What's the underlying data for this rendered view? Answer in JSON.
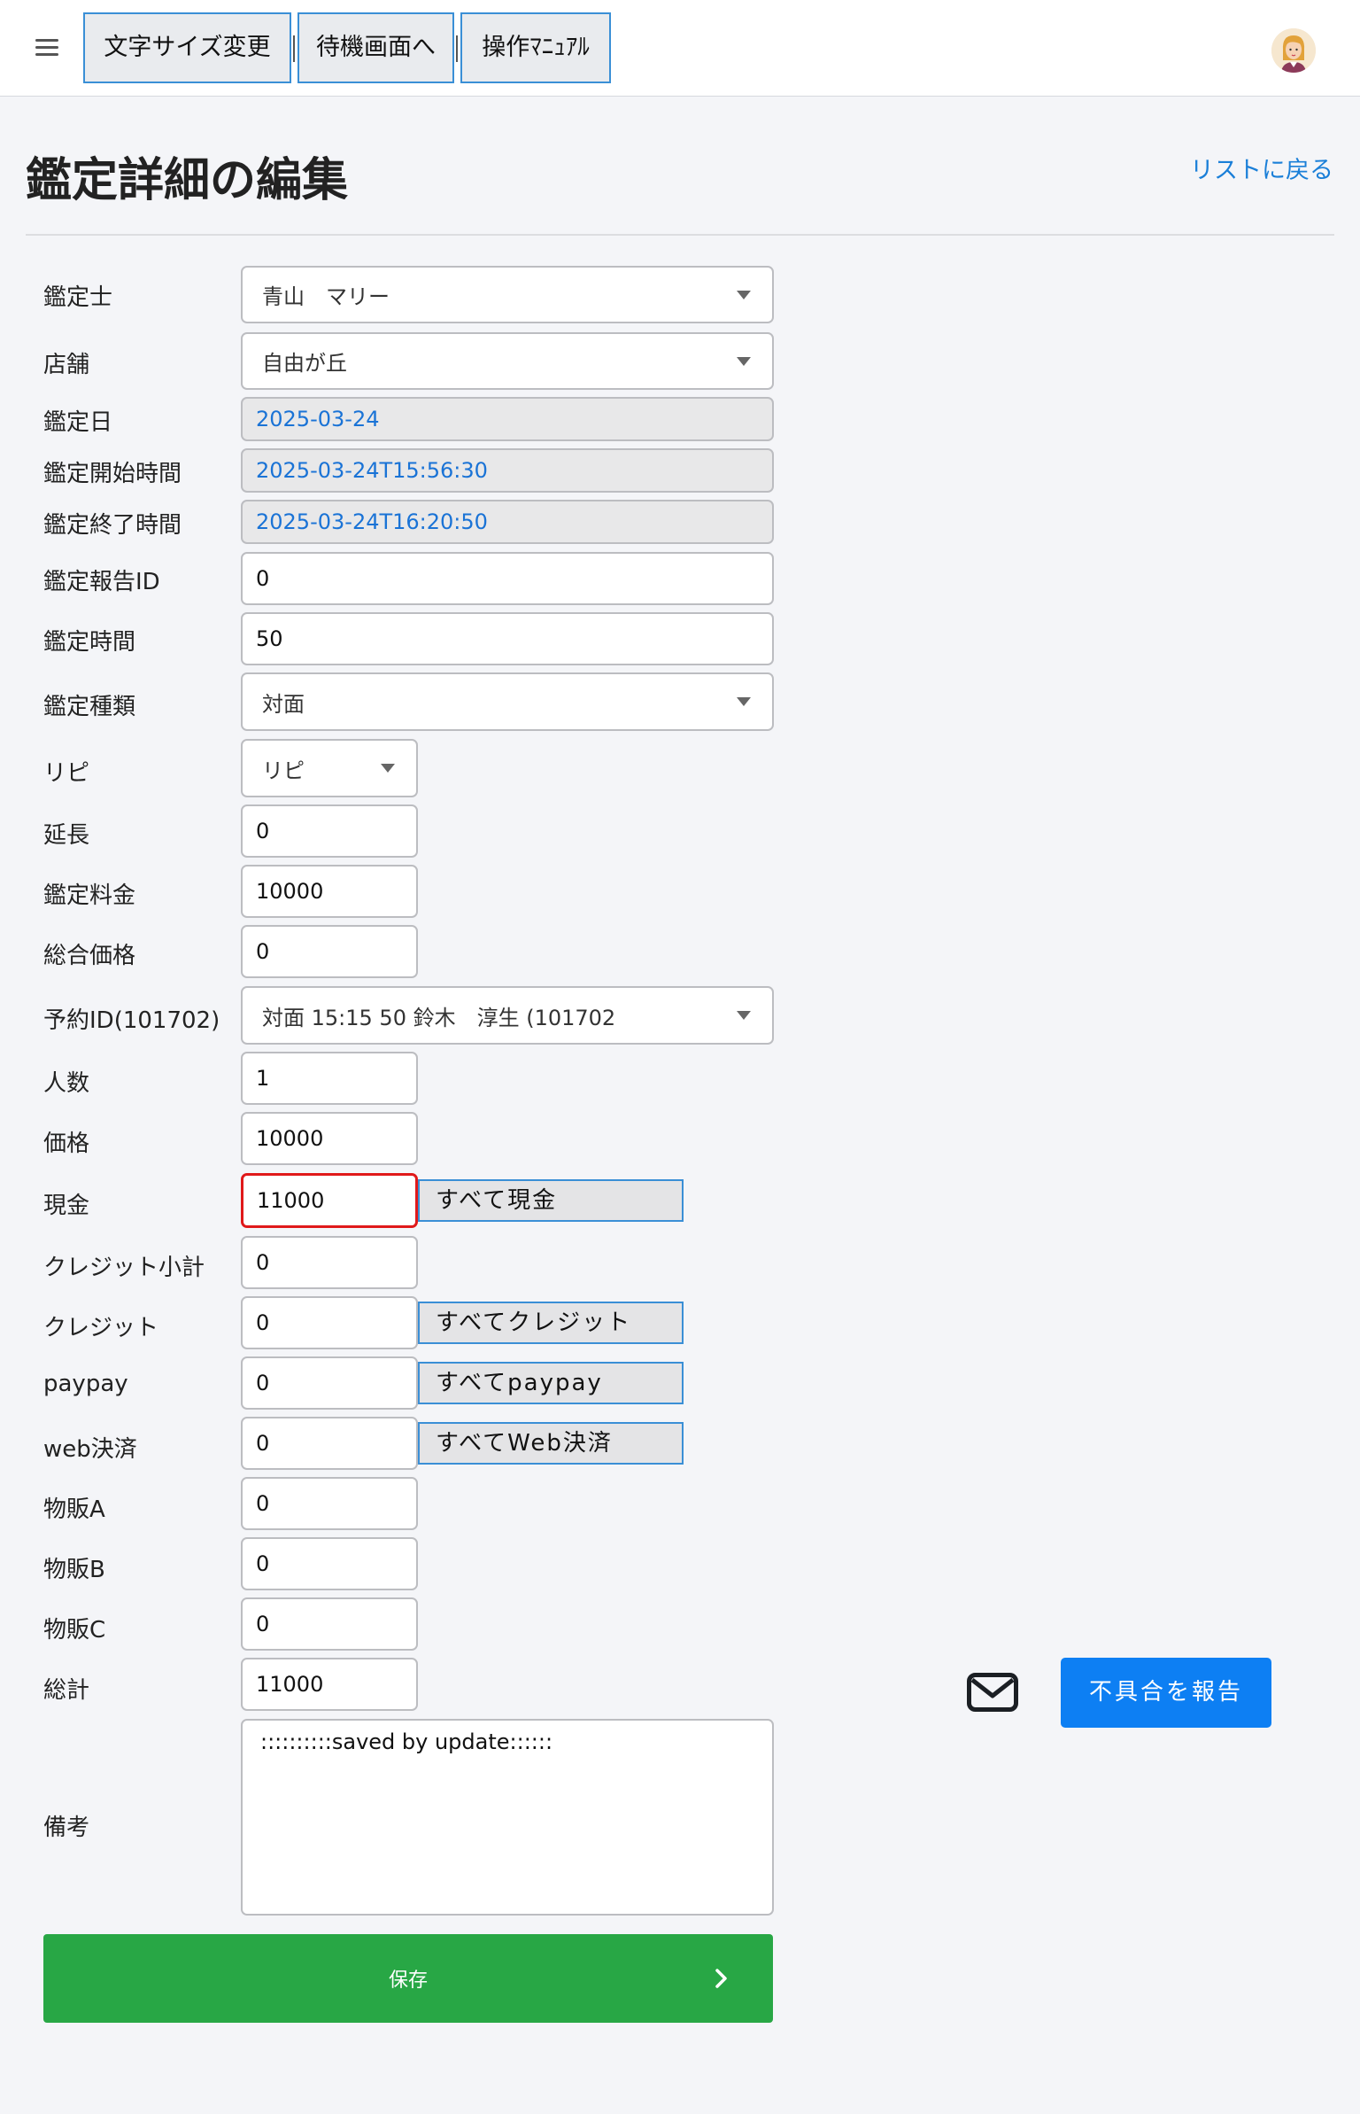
{
  "header": {
    "buttons": [
      "文字サイズ変更",
      "待機画面へ",
      "操作ﾏﾆｭｱﾙ"
    ]
  },
  "page": {
    "title": "鑑定詳細の編集",
    "back_link": "リストに戻る"
  },
  "form": {
    "fortune_teller": {
      "label": "鑑定士",
      "value": "青山　マリー"
    },
    "store": {
      "label": "店舗",
      "value": "自由が丘"
    },
    "date": {
      "label": "鑑定日",
      "value": "2025-03-24"
    },
    "start_time": {
      "label": "鑑定開始時間",
      "value": "2025-03-24T15:56:30"
    },
    "end_time": {
      "label": "鑑定終了時間",
      "value": "2025-03-24T16:20:50"
    },
    "report_id": {
      "label": "鑑定報告ID",
      "value": "0"
    },
    "duration": {
      "label": "鑑定時間",
      "value": "50"
    },
    "type": {
      "label": "鑑定種類",
      "value": "対面"
    },
    "repeat": {
      "label": "リピ",
      "value": "リピ"
    },
    "extension": {
      "label": "延長",
      "value": "0"
    },
    "fee": {
      "label": "鑑定料金",
      "value": "10000"
    },
    "total_price": {
      "label": "総合価格",
      "value": "0"
    },
    "reservation": {
      "label": "予約ID(101702)",
      "value": "対面 15:15 50 鈴木　淳生 (101702"
    },
    "people": {
      "label": "人数",
      "value": "1"
    },
    "price": {
      "label": "価格",
      "value": "10000"
    },
    "cash": {
      "label": "現金",
      "value": "11000",
      "all_button": "すべて現金"
    },
    "credit_subtotal": {
      "label": "クレジット小計",
      "value": "0"
    },
    "credit": {
      "label": "クレジット",
      "value": "0",
      "all_button": "すべてクレジット"
    },
    "paypay": {
      "label": "paypay",
      "value": "0",
      "all_button": "すべてpaypay"
    },
    "web": {
      "label": "web決済",
      "value": "0",
      "all_button": "すべてWeb決済"
    },
    "goods_a": {
      "label": "物販A",
      "value": "0"
    },
    "goods_b": {
      "label": "物販B",
      "value": "0"
    },
    "goods_c": {
      "label": "物販C",
      "value": "0"
    },
    "total": {
      "label": "総計",
      "value": "11000"
    },
    "notes": {
      "label": "備考",
      "value": "::::::::::saved by update::::::"
    }
  },
  "actions": {
    "save": "保存",
    "report_bug": "不具合を報告"
  },
  "icons": {
    "menu": "hamburger-icon",
    "mail": "mail-icon",
    "chevron": "chevron-right-icon",
    "avatar": "user-avatar"
  },
  "colors": {
    "save": "#28a745",
    "report": "#0d7ff3",
    "link": "#1a7fd8",
    "error_border": "#e0191a"
  }
}
